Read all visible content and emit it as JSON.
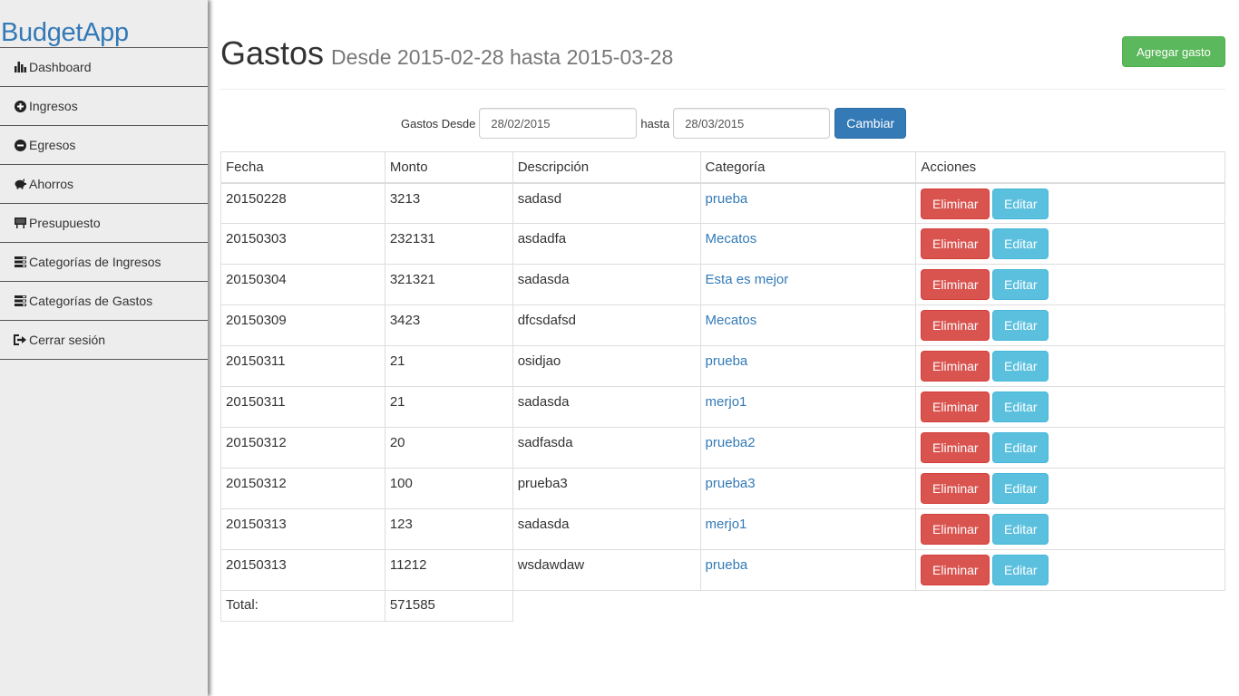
{
  "sidebar": {
    "brand": "BudgetApp",
    "items": [
      {
        "label": "Dashboard",
        "icon": "bar-chart-icon"
      },
      {
        "label": "Ingresos",
        "icon": "plus-circle-icon"
      },
      {
        "label": "Egresos",
        "icon": "minus-circle-icon"
      },
      {
        "label": "Ahorros",
        "icon": "piggy-bank-icon"
      },
      {
        "label": "Presupuesto",
        "icon": "blackboard-icon"
      },
      {
        "label": "Categorías de Ingresos",
        "icon": "tasks-list-icon"
      },
      {
        "label": "Categorías de Gastos",
        "icon": "tasks-list-icon"
      },
      {
        "label": "Cerrar sesión",
        "icon": "log-out-icon"
      }
    ]
  },
  "header": {
    "title": "Gastos",
    "subtitle": "Desde 2015-02-28 hasta 2015-03-28",
    "add_button": "Agregar gasto"
  },
  "filter": {
    "from_label": "Gastos Desde",
    "from_value": "28/02/2015",
    "to_label": "hasta",
    "to_value": "28/03/2015",
    "submit": "Cambiar"
  },
  "table": {
    "columns": [
      "Fecha",
      "Monto",
      "Descripción",
      "Categoría",
      "Acciones"
    ],
    "delete_label": "Eliminar",
    "edit_label": "Editar",
    "rows": [
      {
        "fecha": "20150228",
        "monto": "3213",
        "descripcion": "sadasd",
        "categoria": "prueba"
      },
      {
        "fecha": "20150303",
        "monto": "232131",
        "descripcion": "asdadfa",
        "categoria": "Mecatos"
      },
      {
        "fecha": "20150304",
        "monto": "321321",
        "descripcion": "sadasda",
        "categoria": "Esta es mejor"
      },
      {
        "fecha": "20150309",
        "monto": "3423",
        "descripcion": "dfcsdafsd",
        "categoria": "Mecatos"
      },
      {
        "fecha": "20150311",
        "monto": "21",
        "descripcion": "osidjao",
        "categoria": "prueba"
      },
      {
        "fecha": "20150311",
        "monto": "21",
        "descripcion": "sadasda",
        "categoria": "merjo1"
      },
      {
        "fecha": "20150312",
        "monto": "20",
        "descripcion": "sadfasda",
        "categoria": "prueba2"
      },
      {
        "fecha": "20150312",
        "monto": "100",
        "descripcion": "prueba3",
        "categoria": "prueba3"
      },
      {
        "fecha": "20150313",
        "monto": "123",
        "descripcion": "sadasda",
        "categoria": "merjo1"
      },
      {
        "fecha": "20150313",
        "monto": "11212",
        "descripcion": "wsdawdaw",
        "categoria": "prueba"
      }
    ],
    "total_label": "Total:",
    "total_value": "571585"
  },
  "colors": {
    "brand": "#337ab7",
    "success": "#5cb85c",
    "danger": "#d9534f",
    "info": "#5bc0de",
    "primary": "#337ab7",
    "sidebar_bg": "#ededed"
  }
}
